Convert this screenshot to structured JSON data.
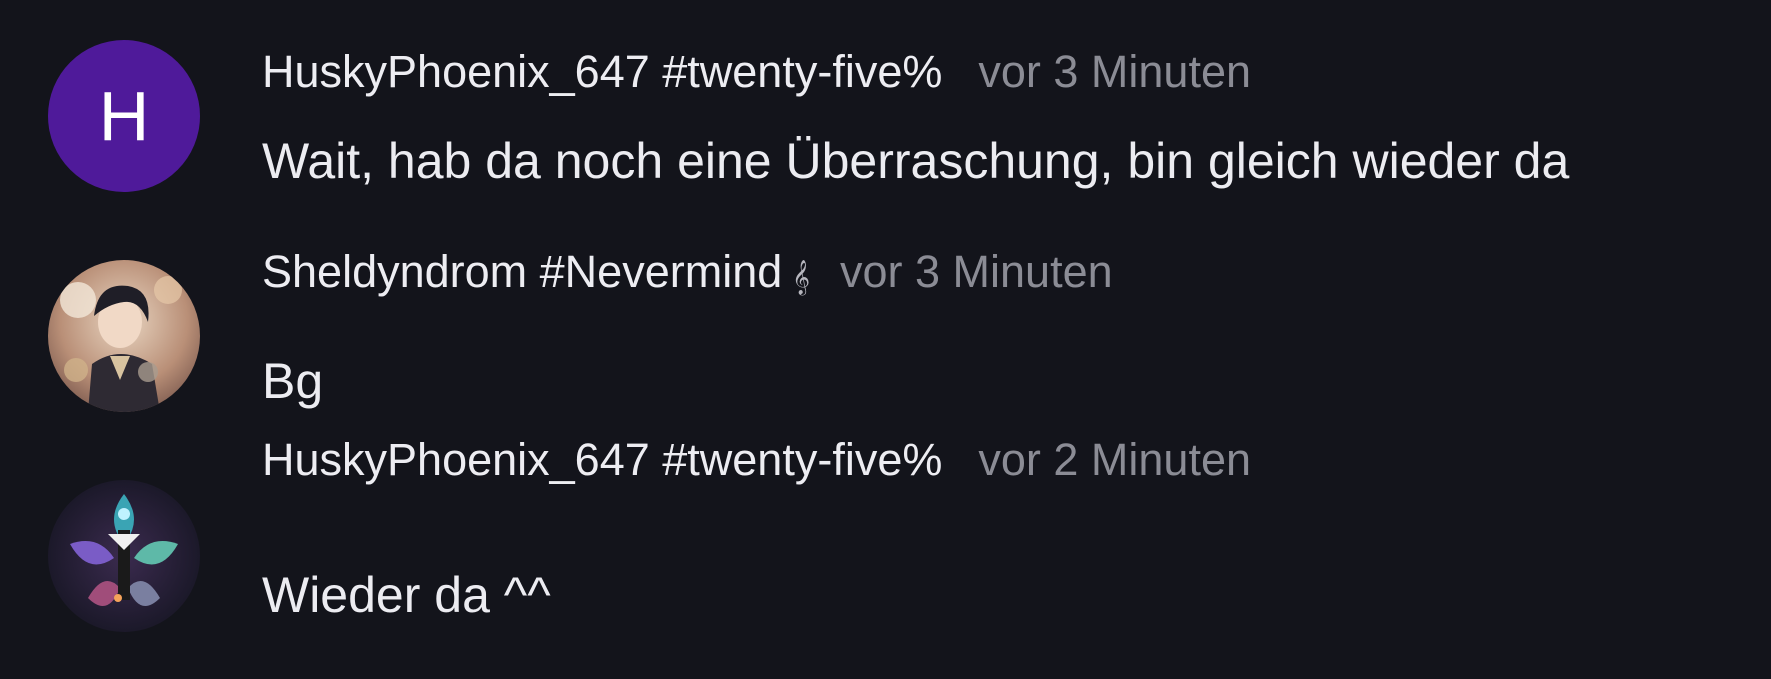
{
  "messages": [
    {
      "avatar_type": "letter",
      "avatar_letter": "H",
      "avatar_color": "#4f1a9a",
      "username": "HuskyPhoenix_647 #twenty-five%",
      "timestamp": "vor 3 Minuten",
      "text": "Wait, hab da noch eine Überraschung, bin gleich wieder da"
    },
    {
      "avatar_type": "image",
      "avatar_icon": "anime-character-avatar",
      "username": "Sheldyndrom #Nevermind",
      "username_icon": "treble-clef-icon",
      "username_icon_glyph": "𝄞",
      "timestamp": "vor 3 Minuten",
      "text": "Bg"
    },
    {
      "avatar_type": "image",
      "avatar_icon": "emblem-avatar",
      "username": "HuskyPhoenix_647 #twenty-five%",
      "timestamp": "vor 2 Minuten",
      "text": "Wieder da ^^"
    }
  ],
  "colors": {
    "background": "#13141b",
    "username": "#ededf2",
    "timestamp": "#8b8c95",
    "text": "#ececf1"
  }
}
